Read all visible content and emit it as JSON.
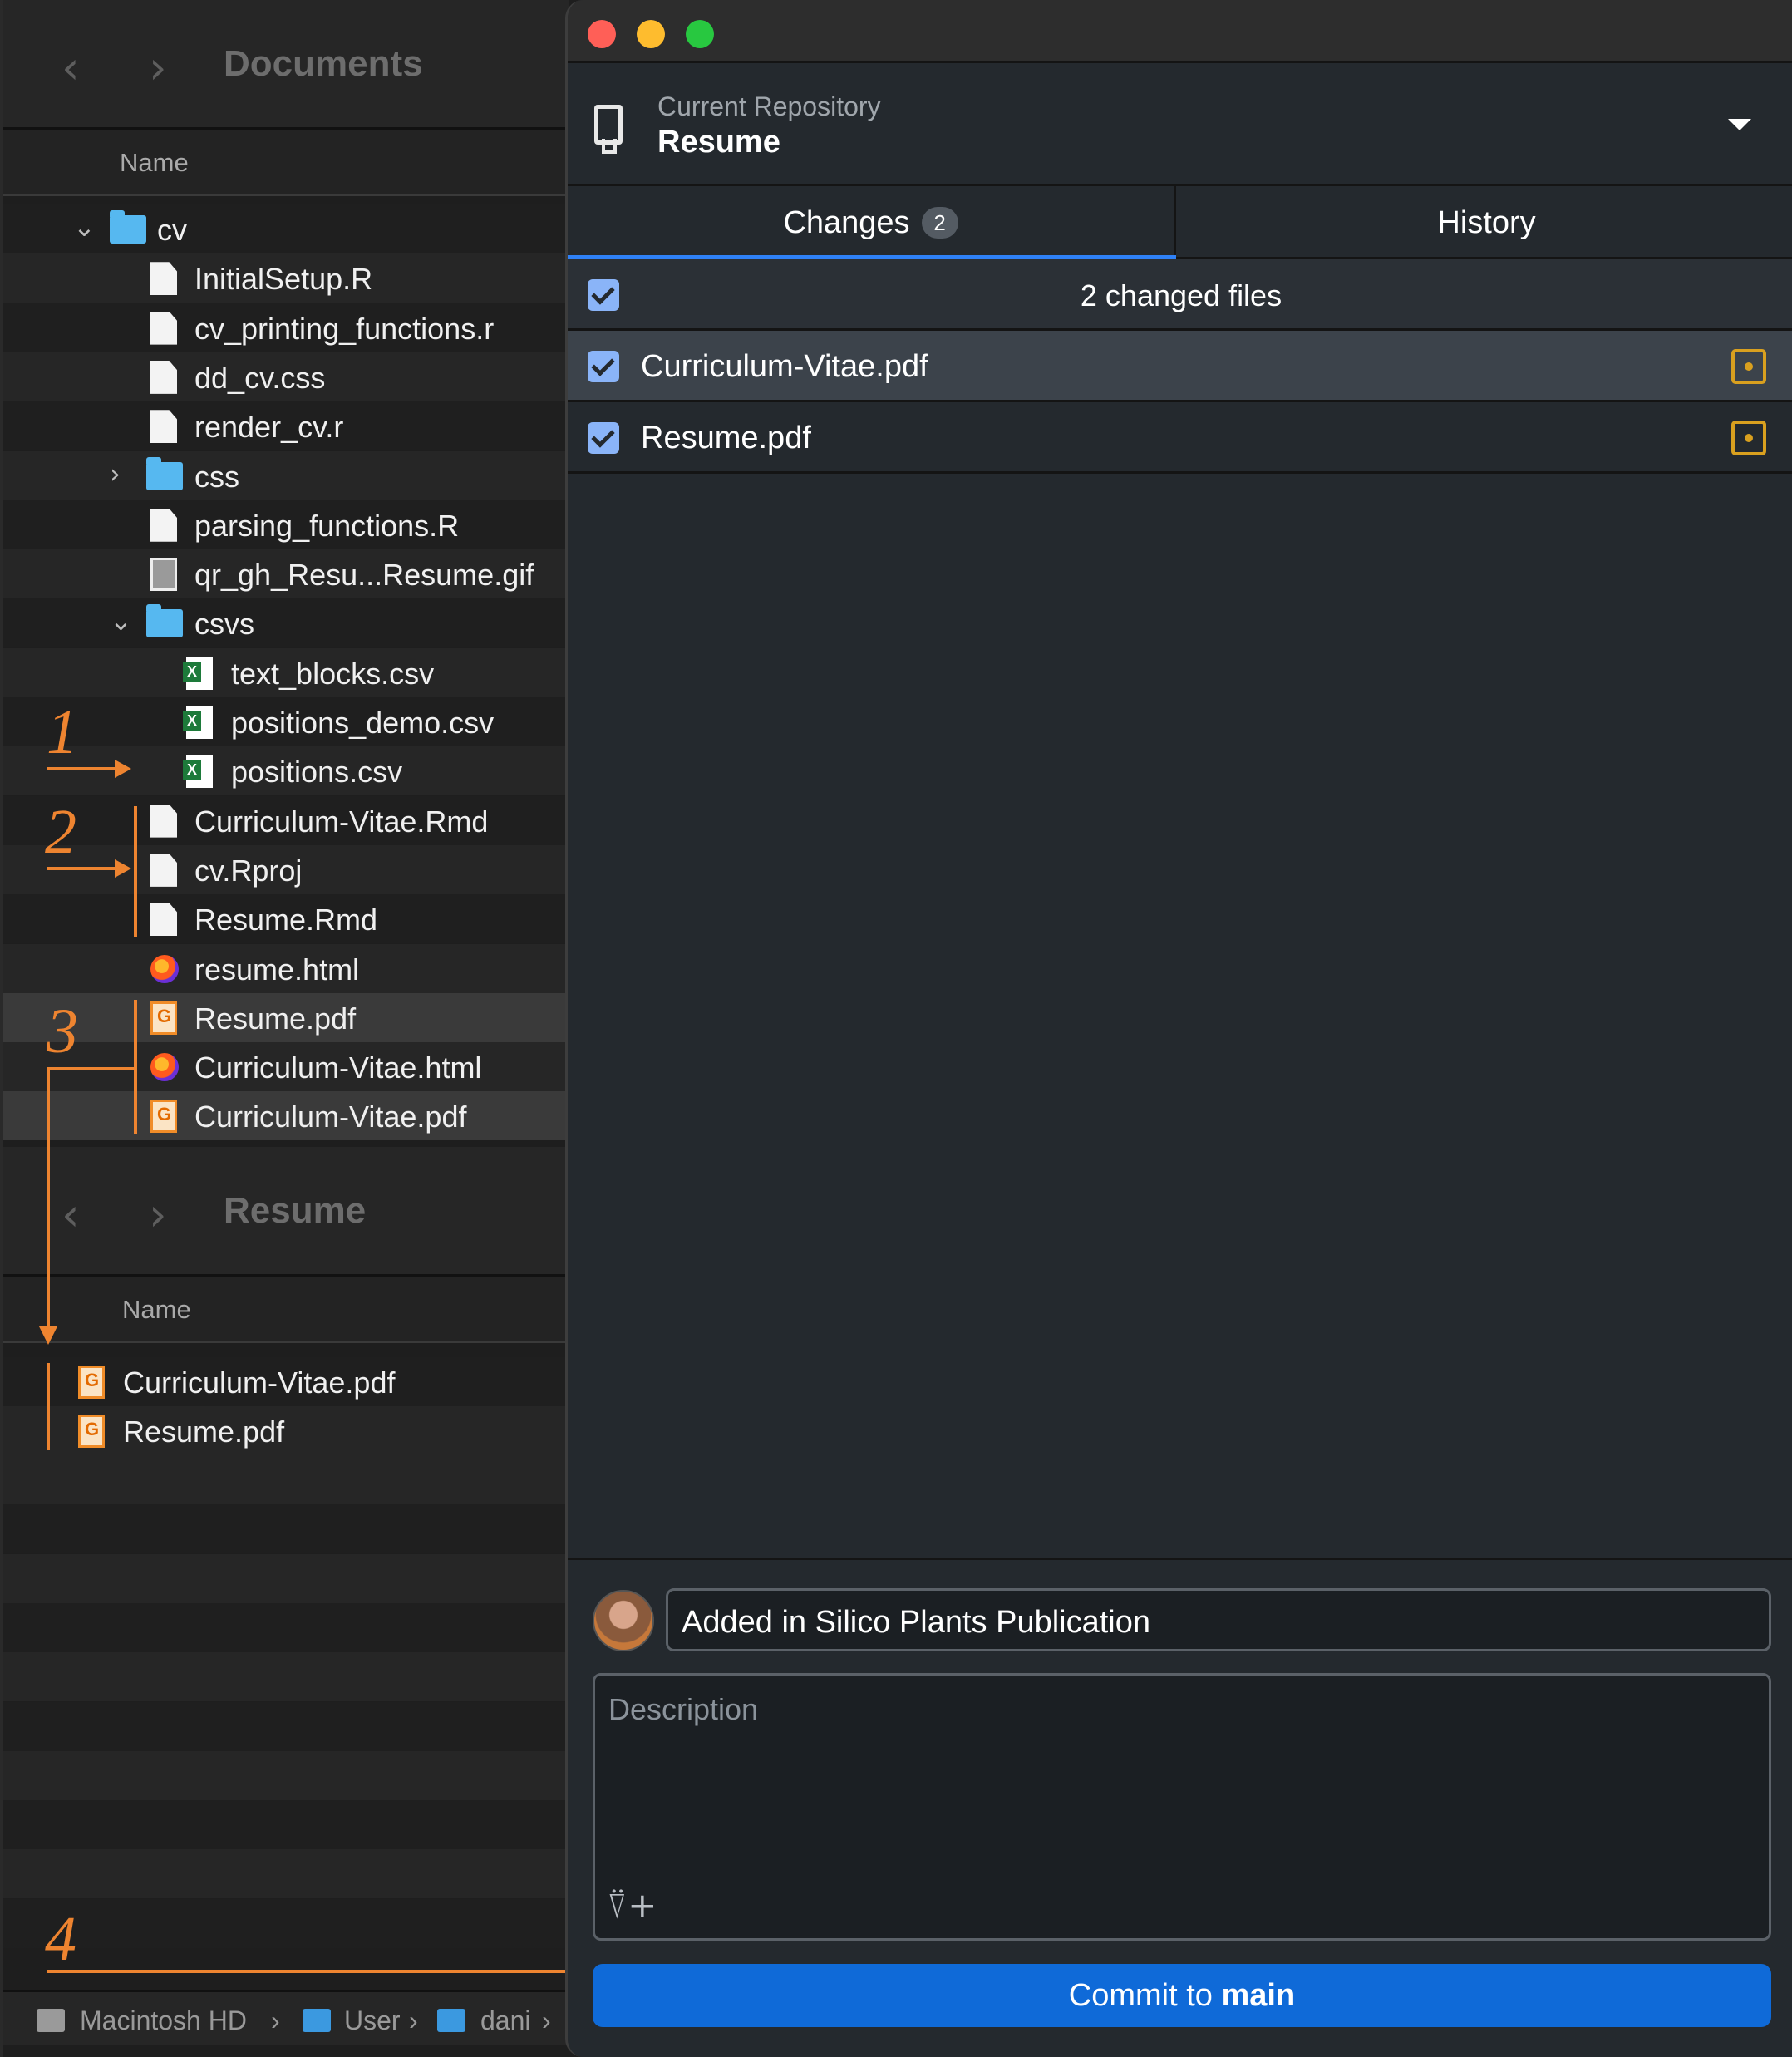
{
  "finder_top": {
    "back_glyph": "‹",
    "forward_glyph": "›",
    "title": "Documents",
    "column_header": "Name",
    "rows": [
      {
        "name": "cv",
        "kind": "folder",
        "disclosure": "⌄",
        "icon": "folder-icon"
      },
      {
        "name": "InitialSetup.R",
        "kind": "doc",
        "icon": "document-icon"
      },
      {
        "name": "cv_printing_functions.r",
        "kind": "doc",
        "icon": "document-icon"
      },
      {
        "name": "dd_cv.css",
        "kind": "doc",
        "icon": "document-icon"
      },
      {
        "name": "render_cv.r",
        "kind": "doc",
        "icon": "document-icon"
      },
      {
        "name": "css",
        "kind": "folder",
        "disclosure": "›",
        "icon": "folder-icon"
      },
      {
        "name": "parsing_functions.R",
        "kind": "doc",
        "icon": "document-icon"
      },
      {
        "name": "qr_gh_Resu...Resume.gif",
        "kind": "img",
        "icon": "image-icon"
      },
      {
        "name": "csvs",
        "kind": "folder",
        "disclosure": "⌄",
        "icon": "folder-icon"
      },
      {
        "name": "text_blocks.csv",
        "kind": "csv",
        "icon": "spreadsheet-icon"
      },
      {
        "name": "positions_demo.csv",
        "kind": "csv",
        "icon": "spreadsheet-icon"
      },
      {
        "name": "positions.csv",
        "kind": "csv",
        "icon": "spreadsheet-icon"
      },
      {
        "name": "Curriculum-Vitae.Rmd",
        "kind": "doc",
        "icon": "document-icon"
      },
      {
        "name": "cv.Rproj",
        "kind": "doc",
        "icon": "document-icon"
      },
      {
        "name": "Resume.Rmd",
        "kind": "doc",
        "icon": "document-icon"
      },
      {
        "name": "resume.html",
        "kind": "html",
        "icon": "browser-icon"
      },
      {
        "name": "Resume.pdf",
        "kind": "pdf",
        "icon": "pdf-icon"
      },
      {
        "name": "Curriculum-Vitae.html",
        "kind": "html",
        "icon": "browser-icon"
      },
      {
        "name": "Curriculum-Vitae.pdf",
        "kind": "pdf",
        "icon": "pdf-icon"
      }
    ]
  },
  "finder_bottom": {
    "back_glyph": "‹",
    "forward_glyph": "›",
    "title": "Resume",
    "column_header": "Name",
    "rows": [
      {
        "name": "Curriculum-Vitae.pdf",
        "kind": "pdf",
        "icon": "pdf-icon"
      },
      {
        "name": "Resume.pdf",
        "kind": "pdf",
        "icon": "pdf-icon"
      }
    ]
  },
  "path_bar": {
    "segments": [
      "Macintosh HD",
      "User",
      "dani"
    ],
    "separator": "›"
  },
  "annotations": [
    "1",
    "2",
    "3",
    "4"
  ],
  "github": {
    "repo_label": "Current Repository",
    "repo_name": "Resume",
    "tabs": {
      "changes": "Changes",
      "changes_count": "2",
      "history": "History"
    },
    "changed_summary": "2 changed files",
    "files": [
      "Curriculum-Vitae.pdf",
      "Resume.pdf"
    ],
    "commit_summary": "Added in Silico Plants Publication",
    "description_placeholder": "Description",
    "coauthor_glyph": "⍢+",
    "commit_button_prefix": "Commit to ",
    "commit_branch": "main"
  },
  "colors": {
    "accent_blue": "#0f6ad8",
    "annotation_orange": "#ee8430",
    "modified_yellow": "#d9a01f",
    "traffic_red": "#ff5f57",
    "traffic_yellow": "#febc2e",
    "traffic_green": "#28c840"
  }
}
